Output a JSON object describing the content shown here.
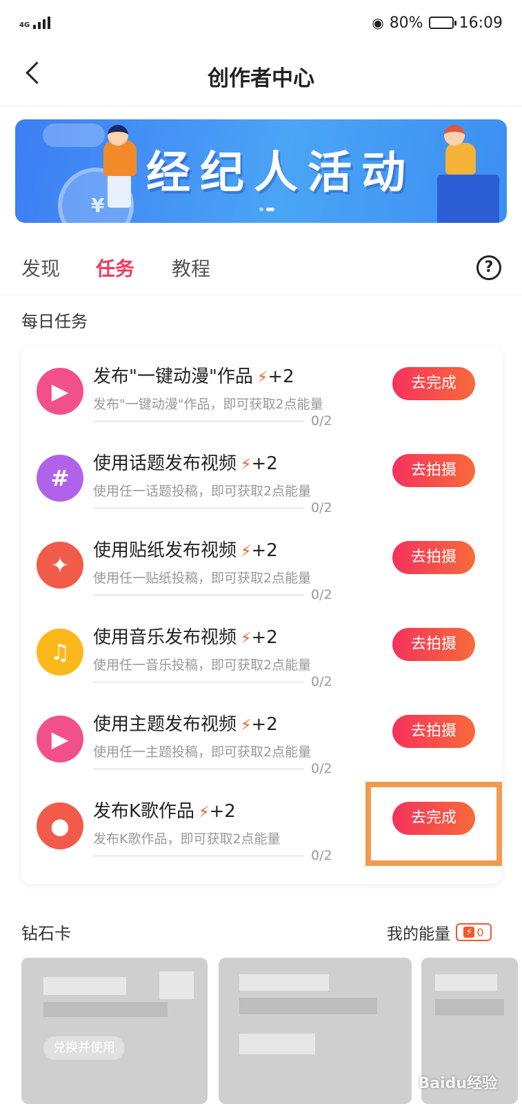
{
  "status_bar": {
    "network": "4G",
    "battery_percent": "80%",
    "battery_level": 0.8,
    "time": "16:09"
  },
  "nav": {
    "title": "创作者中心"
  },
  "banner": {
    "text": "经纪人活动",
    "colors": {
      "start": "#3d7df5",
      "end": "#4aa5f5"
    }
  },
  "tabs": [
    {
      "label": "发现",
      "active": false
    },
    {
      "label": "任务",
      "active": true
    },
    {
      "label": "教程",
      "active": false
    }
  ],
  "section_title": "每日任务",
  "tasks": [
    {
      "title": "发布\"一键动漫\"作品",
      "energy": "+2",
      "desc": "发布\"一键动漫\"作品，即可获取2点能量",
      "count": "0/2",
      "progress": 0,
      "button": "去完成",
      "icon": "video-icon",
      "icon_color": "#f2508a"
    },
    {
      "title": "使用话题发布视频",
      "energy": "+2",
      "desc": "使用任一话题投稿，即可获取2点能量",
      "count": "0/2",
      "progress": 0,
      "button": "去拍摄",
      "icon": "hashtag-icon",
      "icon_color": "#b063e8"
    },
    {
      "title": "使用贴纸发布视频",
      "energy": "+2",
      "desc": "使用任一贴纸投稿，即可获取2点能量",
      "count": "0/2",
      "progress": 0,
      "button": "去拍摄",
      "icon": "sticker-icon",
      "icon_color": "#f25a4a"
    },
    {
      "title": "使用音乐发布视频",
      "energy": "+2",
      "desc": "使用任一音乐投稿，即可获取2点能量",
      "count": "0/2",
      "progress": 0,
      "button": "去拍摄",
      "icon": "music-icon",
      "icon_color": "#fbb81a"
    },
    {
      "title": "使用主题发布视频",
      "energy": "+2",
      "desc": "使用任一主题投稿，即可获取2点能量",
      "count": "0/2",
      "progress": 0,
      "button": "去拍摄",
      "icon": "video-icon",
      "icon_color": "#f2508a"
    },
    {
      "title": "发布K歌作品",
      "energy": "+2",
      "desc": "发布K歌作品，即可获取2点能量",
      "count": "0/2",
      "progress": 0,
      "button": "去完成",
      "icon": "microphone-icon",
      "icon_color": "#f25a4a"
    }
  ],
  "diamond": {
    "title": "钻石卡",
    "my_energy_label": "我的能量",
    "energy_value": "0",
    "card_pill": "兑换并使用"
  },
  "watermark": "Baidu经验",
  "accent": "#f03b5b",
  "highlight_color": "#f29b4e"
}
